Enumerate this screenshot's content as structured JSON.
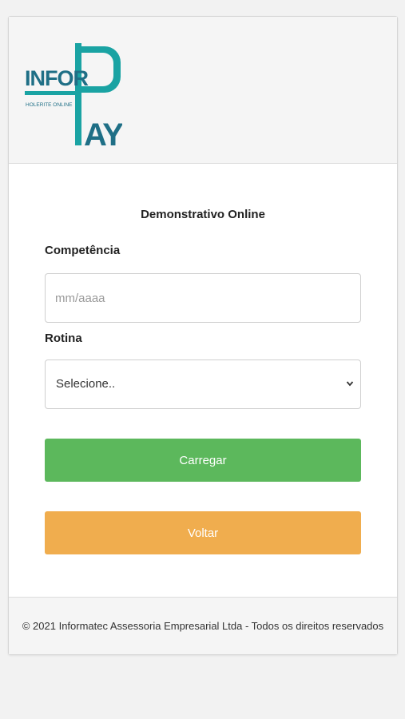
{
  "brand": {
    "logo_text_infor": "INFOR",
    "logo_text_pay": "AY",
    "logo_subtitle": "HOLERITE ONLINE",
    "color_dark": "#1f6f86",
    "color_teal": "#1aa3a3"
  },
  "form": {
    "title": "Demonstrativo Online",
    "competencia_label": "Competência",
    "competencia_placeholder": "mm/aaaa",
    "competencia_value": "",
    "rotina_label": "Rotina",
    "rotina_selected": "Selecione..",
    "load_button": "Carregar",
    "back_button": "Voltar"
  },
  "colors": {
    "load_button": "#5cb85c",
    "back_button": "#f0ad4e"
  },
  "footer": {
    "text": "© 2021 Informatec Assessoria Empresarial Ltda - Todos os direitos reservados"
  }
}
